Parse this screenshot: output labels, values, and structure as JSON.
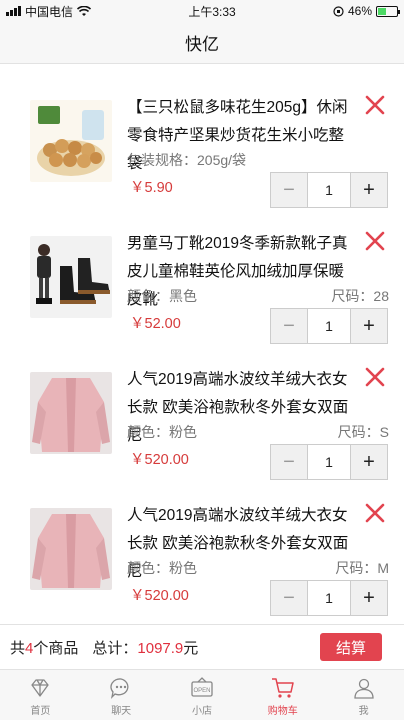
{
  "status_bar": {
    "carrier": "中国电信",
    "time": "上午3:33",
    "battery": "46%"
  },
  "header": {
    "title": "快亿"
  },
  "cart": {
    "items": [
      {
        "title": "【三只松鼠多味花生205g】休闲零食特产坚果炒货花生米小吃整袋",
        "spec_left": "包装规格：205g/袋",
        "spec_right": "",
        "price": "￥5.90",
        "quantity": "1",
        "minus": "−",
        "plus": "+"
      },
      {
        "title": "男童马丁靴2019冬季新款靴子真皮儿童棉鞋英伦风加绒加厚保暖皮靴",
        "spec_left": "颜色：黑色",
        "spec_right": "尺码：28",
        "price": "￥52.00",
        "quantity": "1",
        "minus": "−",
        "plus": "+"
      },
      {
        "title": "人气2019高端水波纹羊绒大衣女长款 欧美浴袍款秋冬外套女双面尼",
        "spec_left": "颜色：粉色",
        "spec_right": "尺码：S",
        "price": "￥520.00",
        "quantity": "1",
        "minus": "−",
        "plus": "+"
      },
      {
        "title": "人气2019高端水波纹羊绒大衣女长款 欧美浴袍款秋冬外套女双面尼",
        "spec_left": "颜色：粉色",
        "spec_right": "尺码：M",
        "price": "￥520.00",
        "quantity": "1",
        "minus": "−",
        "plus": "+"
      }
    ]
  },
  "summary": {
    "count_prefix": "共",
    "count": "4",
    "count_suffix": "个商品",
    "total_label": "总计：",
    "total_value": "1097.9",
    "total_unit": "元",
    "checkout_label": "结算"
  },
  "tabbar": {
    "tabs": [
      {
        "label": "首页",
        "icon": "diamond-icon"
      },
      {
        "label": "聊天",
        "icon": "chat-icon"
      },
      {
        "label": "小店",
        "icon": "shop-icon",
        "icon_text": "OPEN"
      },
      {
        "label": "购物车",
        "icon": "cart-icon"
      },
      {
        "label": "我",
        "icon": "person-icon"
      }
    ],
    "active_index": 3
  },
  "colors": {
    "accent": "#e2444f",
    "price": "#d63b3b",
    "wifi_battery": "#4cd964"
  }
}
